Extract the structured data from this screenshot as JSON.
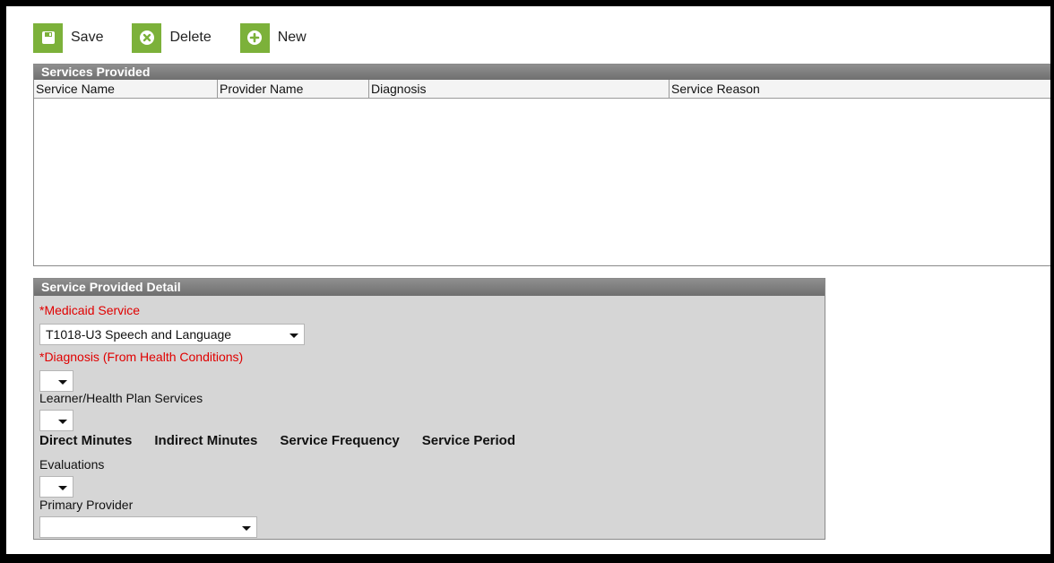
{
  "toolbar": {
    "save_label": "Save",
    "delete_label": "Delete",
    "new_label": "New",
    "icon_color": "#7cb13a"
  },
  "services_provided": {
    "title": "Services Provided",
    "columns": [
      "Service Name",
      "Provider Name",
      "Diagnosis",
      "Service Reason"
    ]
  },
  "detail": {
    "title": "Service Provided Detail",
    "medicaid_service_label": "*Medicaid Service",
    "medicaid_service_value": "T1018-U3 Speech and Language",
    "diagnosis_label": "*Diagnosis (From Health Conditions)",
    "diagnosis_value": "",
    "learner_plan_label": "Learner/Health Plan Services",
    "learner_plan_value": "",
    "minutes_headers": [
      "Direct Minutes",
      "Indirect Minutes",
      "Service Frequency",
      "Service Period"
    ],
    "evaluations_label": "Evaluations",
    "evaluations_value": "",
    "primary_provider_label": "Primary Provider",
    "primary_provider_value": "",
    "required_color": "#e00000"
  }
}
